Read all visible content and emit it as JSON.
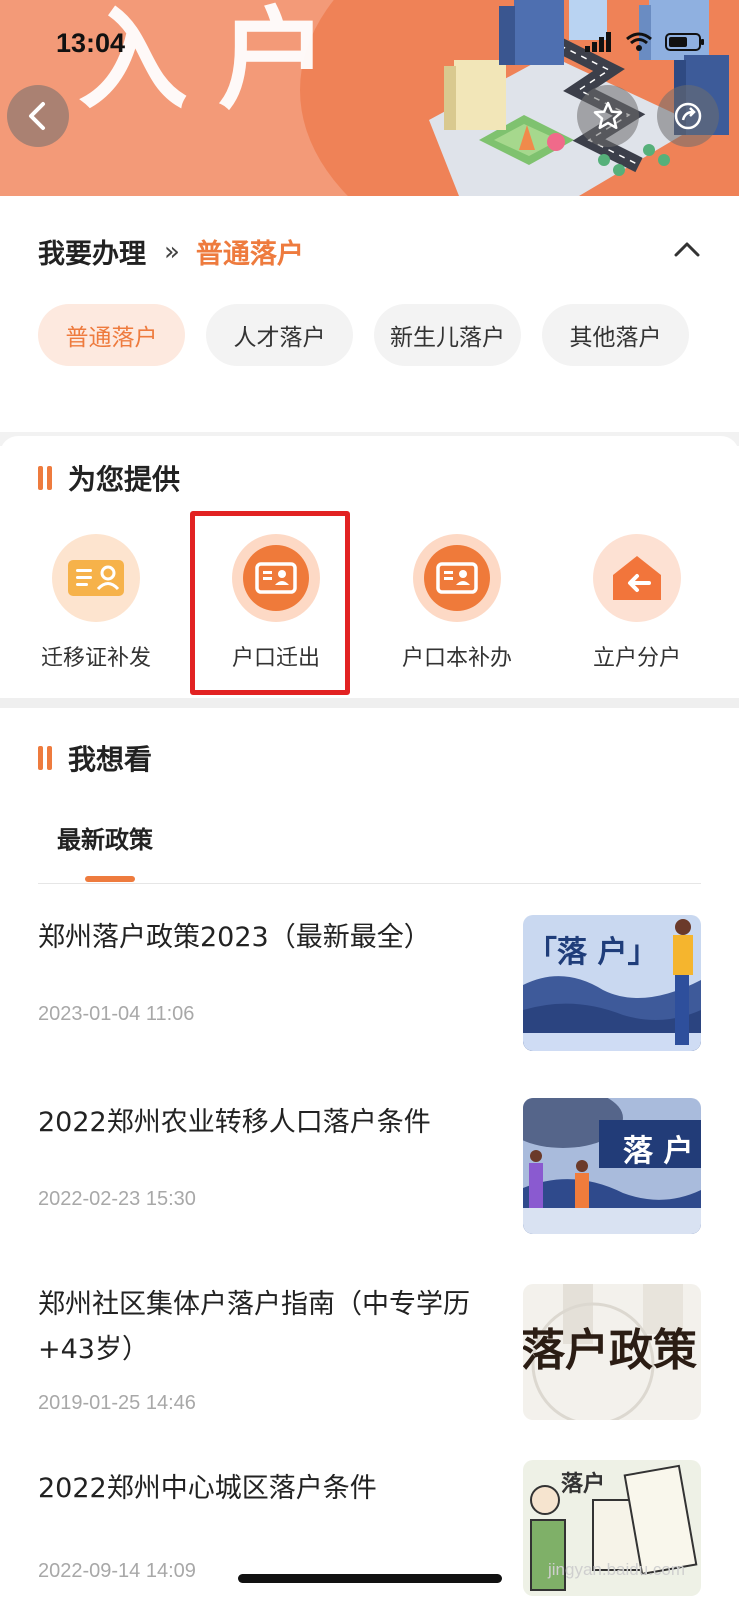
{
  "banner": {
    "title": "入户"
  },
  "status_bar": {
    "time": "13:04"
  },
  "handle": {
    "label": "我要办理",
    "arrows": "»",
    "current": "普通落户",
    "chips": [
      "普通落户",
      "人才落户",
      "新生儿落户",
      "其他落户"
    ]
  },
  "services": {
    "title": "为您提供",
    "items": [
      {
        "label": "迁移证补发",
        "icon": "id-card-person-icon"
      },
      {
        "label": "户口迁出",
        "icon": "id-card-icon"
      },
      {
        "label": "户口本补办",
        "icon": "id-card-icon"
      },
      {
        "label": "立户分户",
        "icon": "house-arrow-icon"
      }
    ]
  },
  "watch": {
    "title": "我想看",
    "tab": "最新政策",
    "news": [
      {
        "title": "郑州落户政策2023（最新最全）",
        "time": "2023-01-04 11:06",
        "thumb_text": "「落 户」"
      },
      {
        "title": "2022郑州农业转移人口落户条件",
        "time": "2022-02-23 15:30",
        "thumb_text": "落 户"
      },
      {
        "title": "郑州社区集体户落户指南（中专学历+43岁）",
        "time": "2019-01-25 14:46",
        "thumb_text": "落户政策"
      },
      {
        "title": "2022郑州中心城区落户条件",
        "time": "2022-09-14 14:09",
        "thumb_text": "落户"
      }
    ]
  },
  "watermark": "jingyan.baidu.com",
  "colors": {
    "accent": "#ee7b3e",
    "banner": "#f39a78",
    "highlight": "#e22222"
  }
}
